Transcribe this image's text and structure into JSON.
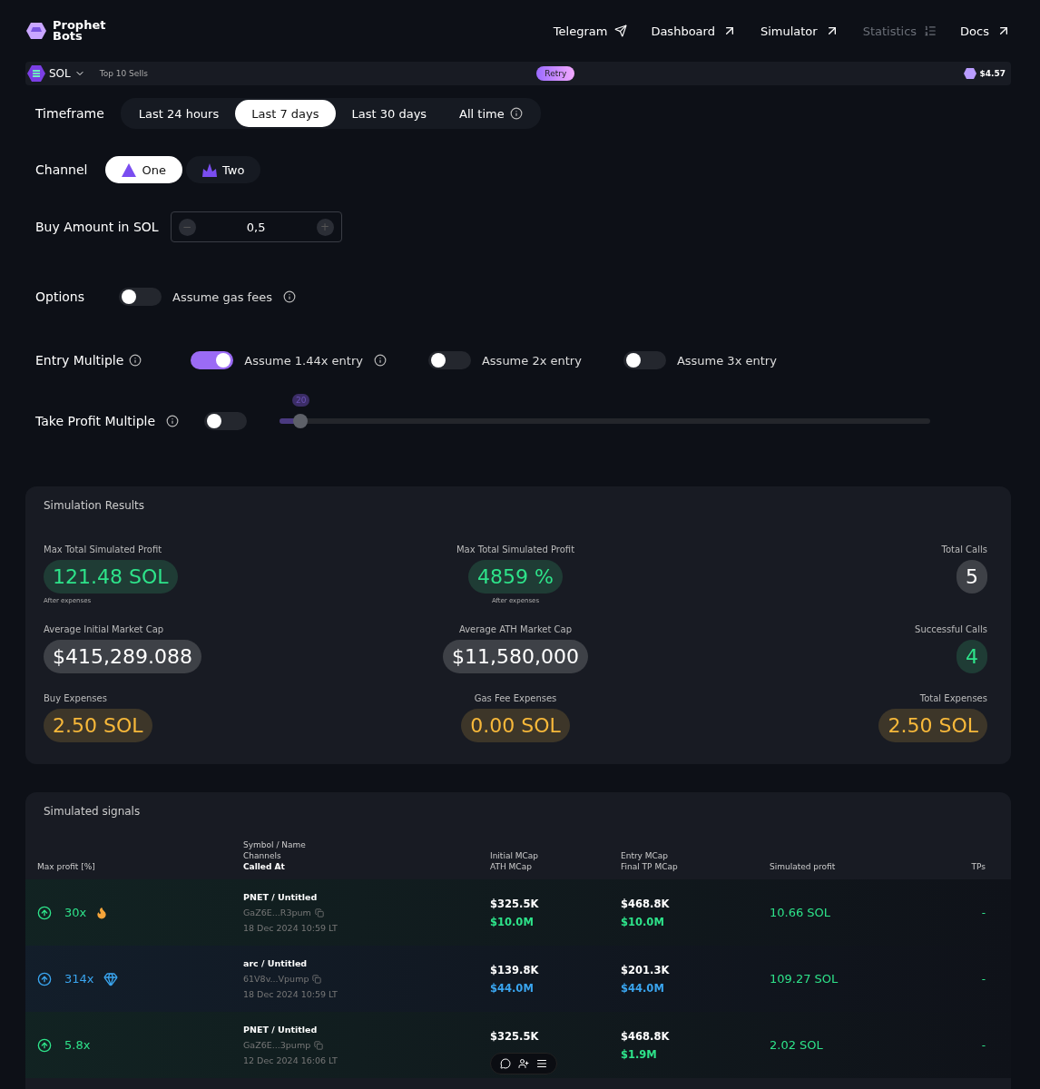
{
  "brand": {
    "name_line_1": "Prophet",
    "name_line_2": "Bots"
  },
  "nav": [
    {
      "label": "Telegram",
      "kind": "telegram",
      "disabled": false
    },
    {
      "label": "Dashboard",
      "kind": "external",
      "disabled": false
    },
    {
      "label": "Simulator",
      "kind": "external",
      "disabled": false
    },
    {
      "label": "Statistics",
      "kind": "list",
      "disabled": true
    },
    {
      "label": "Docs",
      "kind": "external",
      "disabled": false
    }
  ],
  "ticker": {
    "chain": "SOL",
    "feed": "Top 10 Sells",
    "retry": "Retry",
    "price": "$4.57"
  },
  "timeframe": {
    "label": "Timeframe",
    "options": [
      {
        "label": "Last 24 hours",
        "selected": false,
        "info": false
      },
      {
        "label": "Last 7 days",
        "selected": true,
        "info": false
      },
      {
        "label": "Last 30 days",
        "selected": false,
        "info": false
      },
      {
        "label": "All time",
        "selected": false,
        "info": true
      }
    ]
  },
  "channel": {
    "label": "Channel",
    "options": [
      {
        "label": "One",
        "selected": true,
        "kind": "triangle"
      },
      {
        "label": "Two",
        "selected": false,
        "kind": "crown"
      }
    ]
  },
  "buy_amount": {
    "label": "Buy Amount in SOL",
    "value": "0,5",
    "minus": "−",
    "plus": "+"
  },
  "options": {
    "label": "Options",
    "toggles": [
      {
        "label": "Assume gas fees",
        "on": false,
        "info": true
      }
    ]
  },
  "entry_multiple": {
    "label": "Entry Multiple",
    "toggles": [
      {
        "label": "Assume 1.44x entry",
        "on": true,
        "info": true
      },
      {
        "label": "Assume 2x entry",
        "on": false,
        "info": false
      },
      {
        "label": "Assume 3x entry",
        "on": false,
        "info": false
      }
    ]
  },
  "take_profit": {
    "label": "Take Profit Multiple",
    "on": false,
    "slider_value": "20",
    "level": 0.032
  },
  "results": {
    "title": "Simulation Results",
    "stats": [
      {
        "label": "Max Total Simulated Profit",
        "value": "121.48 SOL",
        "color": "#2ee38a",
        "note": "After expenses"
      },
      {
        "label": "Max Total Simulated Profit",
        "value": "4859 %",
        "color": "#2ee38a",
        "note": "After expenses"
      },
      {
        "label": "Total Calls",
        "value": "5",
        "color": "#ffffff"
      },
      {
        "label": "Average Initial Market Cap",
        "value": "$415,289.088",
        "color": "#ffffff"
      },
      {
        "label": "Average ATH Market Cap",
        "value": "$11,580,000",
        "color": "#ffffff"
      },
      {
        "label": "Successful Calls",
        "value": "4",
        "color": "#2ee38a"
      },
      {
        "label": "Buy Expenses",
        "value": "2.50 SOL",
        "color": "#f7b83a"
      },
      {
        "label": "Gas Fee Expenses",
        "value": "0.00 SOL",
        "color": "#f7b83a"
      },
      {
        "label": "Total Expenses",
        "value": "2.50 SOL",
        "color": "#f7b83a"
      }
    ]
  },
  "signals": {
    "title": "Simulated signals",
    "columns": {
      "max_profit": "Max profit [%]",
      "symbol": "Symbol / Name",
      "channels": "Channels",
      "called_at": "Called At",
      "initial": "Initial MCap",
      "ath": "ATH MCap",
      "entry": "Entry MCap",
      "final_tp": "Final TP MCap",
      "profit": "Simulated profit",
      "tps": "TPs"
    },
    "rows": [
      {
        "color": "#2ee38a",
        "multiple": "30x",
        "kind": "fire",
        "symbol": "PNET / Untitled",
        "address": "GaZ6E...R3pum",
        "called_at": "18 Dec 2024 10:59 LT",
        "initial": "$325.5K",
        "ath": "$10.0M",
        "entry": "$468.8K",
        "final_tp": "$10.0M",
        "profit": "10.66 SOL",
        "tps": "-"
      },
      {
        "color": "#3aa5ef",
        "multiple": "314x",
        "kind": "diamond",
        "symbol": "arc / Untitled",
        "address": "61V8v...Vpump",
        "called_at": "18 Dec 2024 10:59 LT",
        "initial": "$139.8K",
        "ath": "$44.0M",
        "entry": "$201.3K",
        "final_tp": "$44.0M",
        "profit": "109.27 SOL",
        "tps": "-"
      },
      {
        "color": "#2ee38a",
        "multiple": "5.8x",
        "symbol": "PNET / Untitled",
        "address": "GaZ6E...3pump",
        "called_at": "12 Dec 2024 16:06 LT",
        "initial": "$325.5K",
        "entry": "$468.8K",
        "final_tp": "$1.9M",
        "profit": "2.02 SOL",
        "tps": "-"
      }
    ]
  }
}
